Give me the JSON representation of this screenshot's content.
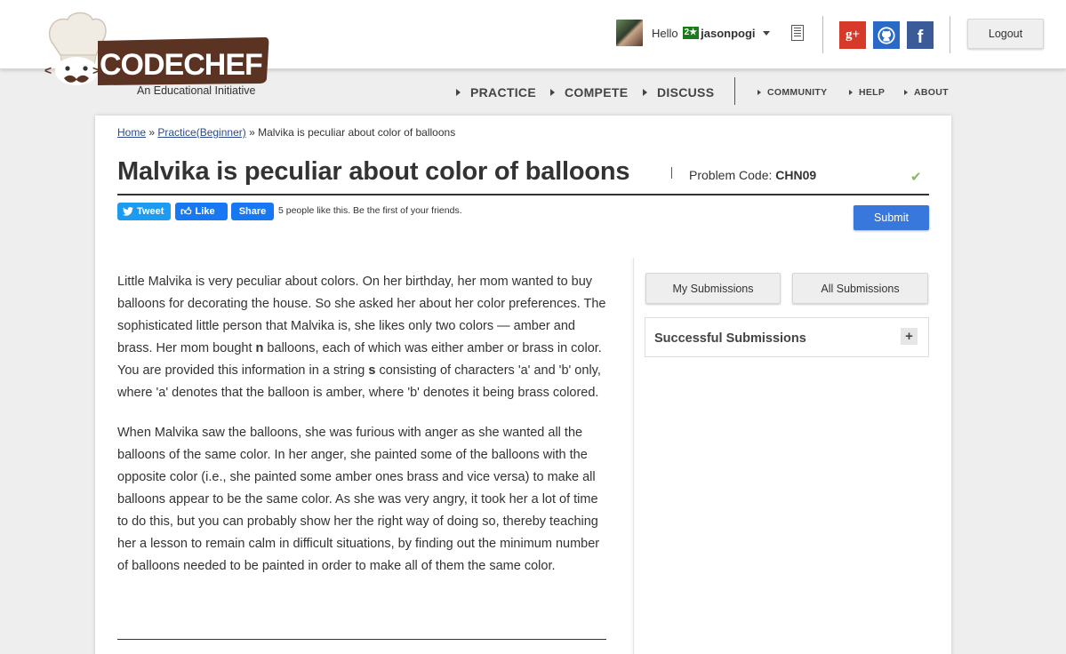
{
  "header": {
    "logo_text": "CODECHEF",
    "logo_tagline": "An Educational Initiative",
    "greeting": "Hello",
    "user_badge": "2★",
    "username": "jasonpogi",
    "logout_label": "Logout",
    "social": {
      "gplus_glyph": "g+",
      "facebook_glyph": "f"
    }
  },
  "nav": {
    "primary": [
      "PRACTICE",
      "COMPETE",
      "DISCUSS"
    ],
    "secondary": [
      "COMMUNITY",
      "HELP",
      "ABOUT"
    ]
  },
  "breadcrumb": {
    "home": "Home",
    "sep1": " » ",
    "practice": "Practice(Beginner)",
    "sep2": " » ",
    "current": "Malvika is peculiar about color of balloons"
  },
  "problem": {
    "title": "Malvika is peculiar about color of balloons",
    "code_label": "Problem Code:",
    "code": "CHN09",
    "status_icon": "checkmark-icon"
  },
  "share": {
    "tweet_label": "Tweet",
    "like_label": "Like",
    "share_label": "Share",
    "likes_text": "5 people like this. Be the first of your friends.",
    "submit_label": "Submit"
  },
  "statement": {
    "p1": [
      "Little Malvika is very peculiar about colors. On her birthday, her mom wanted to buy balloons for decorating the house. So she asked her about her color preferences. The sophisticated little person that Malvika is, she likes only two colors — amber and brass. Her mom bought ",
      "n",
      " balloons, each of which was either amber or brass in color. You are provided this information in a string ",
      "s",
      " consisting of characters 'a' and 'b' only, where 'a' denotes that the balloon is amber, where 'b' denotes it being brass colored."
    ],
    "p2": "When Malvika saw the balloons, she was furious with anger as she wanted all the balloons of the same color. In her anger, she painted some of the balloons with the opposite color (i.e., she painted some amber ones brass and vice versa) to make all balloons appear to be the same color. As she was very angry, it took her a lot of time to do this, but you can probably show her the right way of doing so, thereby teaching her a lesson to remain calm in difficult situations, by finding out the minimum number of balloons needed to be painted in order to make all of them the same color."
  },
  "sidebar": {
    "my_submissions": "My Submissions",
    "all_submissions": "All Submissions",
    "successful_submissions": "Successful Submissions",
    "expand_glyph": "+"
  },
  "colors": {
    "submit_blue": "#3878dc",
    "twitter": "#1d9bf0",
    "facebook": "#1877f2",
    "gplus": "#d53a2b",
    "github": "#2b69c7",
    "fb_icon": "#3a5a98",
    "check_green": "#7dbd5a",
    "logo_brown": "#5a3323"
  }
}
